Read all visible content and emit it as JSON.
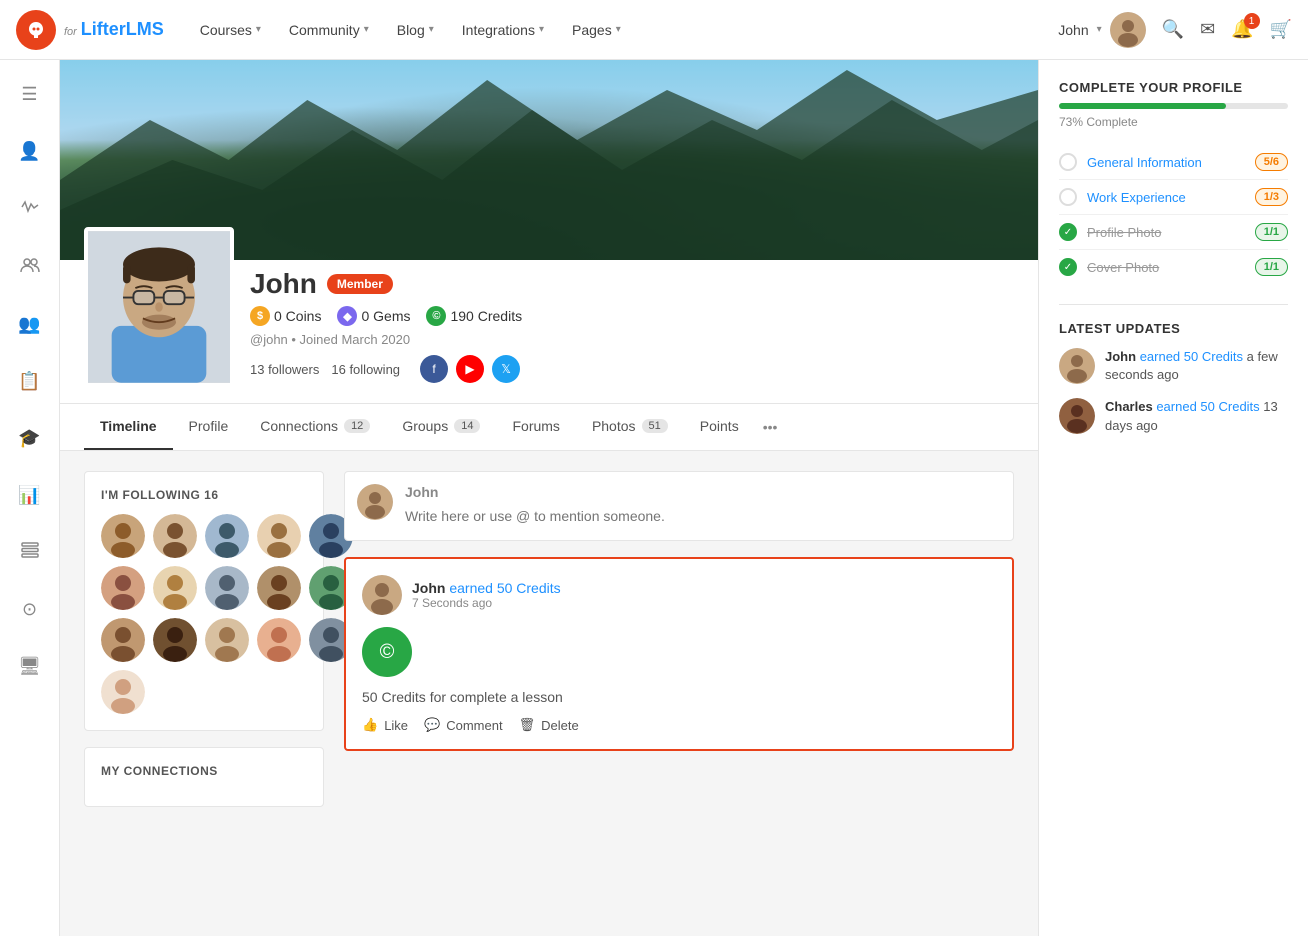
{
  "nav": {
    "logo_letter": "b",
    "logo_for": "for",
    "logo_name": "LifterLMS",
    "links": [
      {
        "label": "Courses",
        "has_chevron": true
      },
      {
        "label": "Community",
        "has_chevron": true
      },
      {
        "label": "Blog",
        "has_chevron": true
      },
      {
        "label": "Integrations",
        "has_chevron": true
      },
      {
        "label": "Pages",
        "has_chevron": true
      }
    ],
    "user_name": "John",
    "notification_count": "1"
  },
  "sidebar": {
    "icons": [
      "person",
      "activity",
      "group",
      "people",
      "list",
      "graduation",
      "chart",
      "tasks",
      "circle",
      "screen"
    ]
  },
  "profile": {
    "name": "John",
    "badge": "Member",
    "coins_label": "0 Coins",
    "gems_label": "0 Gems",
    "credits_label": "190 Credits",
    "meta": "@john • Joined March 2020",
    "followers": "13 followers",
    "following": "16 following"
  },
  "tabs": [
    {
      "label": "Timeline",
      "count": null,
      "active": true
    },
    {
      "label": "Profile",
      "count": null,
      "active": false
    },
    {
      "label": "Connections",
      "count": "12",
      "active": false
    },
    {
      "label": "Groups",
      "count": "14",
      "active": false
    },
    {
      "label": "Forums",
      "count": null,
      "active": false
    },
    {
      "label": "Photos",
      "count": "51",
      "active": false
    },
    {
      "label": "Points",
      "count": null,
      "active": false
    }
  ],
  "following_section": {
    "title": "I'M FOLLOWING 16",
    "count": 16
  },
  "connections_section": {
    "title": "MY CONNECTIONS"
  },
  "compose": {
    "placeholder": "Write here or use @ to mention someone."
  },
  "activity_post": {
    "user": "John",
    "earned_text": "earned 50 Credits",
    "time": "7 Seconds ago",
    "credit_amount": "50 Credits for complete a lesson",
    "actions": [
      "Like",
      "Comment",
      "Delete"
    ]
  },
  "complete_profile": {
    "title": "COMPLETE YOUR PROFILE",
    "progress": 73,
    "progress_text": "73% Complete",
    "items": [
      {
        "label": "General Information",
        "badge": "5/6",
        "done": false,
        "badge_type": "orange"
      },
      {
        "label": "Work Experience",
        "badge": "1/3",
        "done": false,
        "badge_type": "orange"
      },
      {
        "label": "Profile Photo",
        "badge": "1/1",
        "done": true,
        "badge_type": "green"
      },
      {
        "label": "Cover Photo",
        "badge": "1/1",
        "done": true,
        "badge_type": "green"
      }
    ]
  },
  "latest_updates": {
    "title": "LATEST UPDATES",
    "items": [
      {
        "user": "John",
        "text": "earned 50 Credits",
        "time": "a few seconds ago"
      },
      {
        "user": "Charles",
        "text": "earned 50 Credits",
        "time": "13 days ago"
      }
    ]
  }
}
